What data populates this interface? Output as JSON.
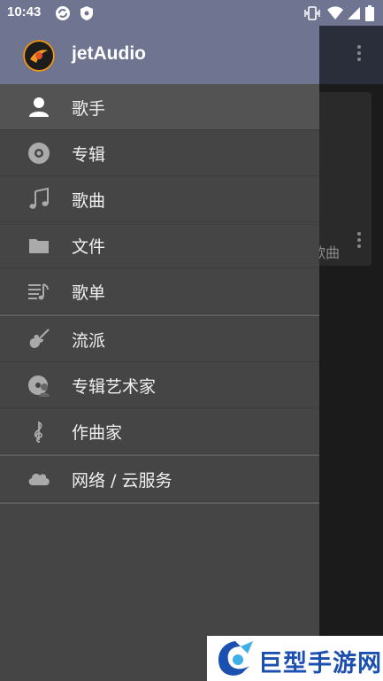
{
  "status_bar": {
    "time": "10:43",
    "icons_left": [
      "sync-icon",
      "shield-icon"
    ],
    "icons_right": [
      "vibrate-icon",
      "wifi-icon",
      "signal-icon",
      "battery-icon"
    ]
  },
  "drawer": {
    "app_name": "jetAudio",
    "sections": [
      [
        {
          "label": "歌手",
          "icon": "artist-icon",
          "active": true
        },
        {
          "label": "专辑",
          "icon": "album-disc-icon",
          "active": false
        },
        {
          "label": "歌曲",
          "icon": "music-note-icon",
          "active": false
        },
        {
          "label": "文件",
          "icon": "folder-icon",
          "active": false
        },
        {
          "label": "歌单",
          "icon": "playlist-icon",
          "active": false
        }
      ],
      [
        {
          "label": "流派",
          "icon": "guitar-icon",
          "active": false
        },
        {
          "label": "专辑艺术家",
          "icon": "album-artist-icon",
          "active": false
        },
        {
          "label": "作曲家",
          "icon": "treble-clef-icon",
          "active": false
        }
      ],
      [
        {
          "label": "网络 / 云服务",
          "icon": "cloud-icon",
          "active": false
        }
      ]
    ]
  },
  "background": {
    "card_label": "歌曲"
  },
  "watermark": {
    "text": "巨型手游网"
  },
  "colors": {
    "header": "#6f7491",
    "drawer_bg": "#454545",
    "active_item": "#535353"
  }
}
